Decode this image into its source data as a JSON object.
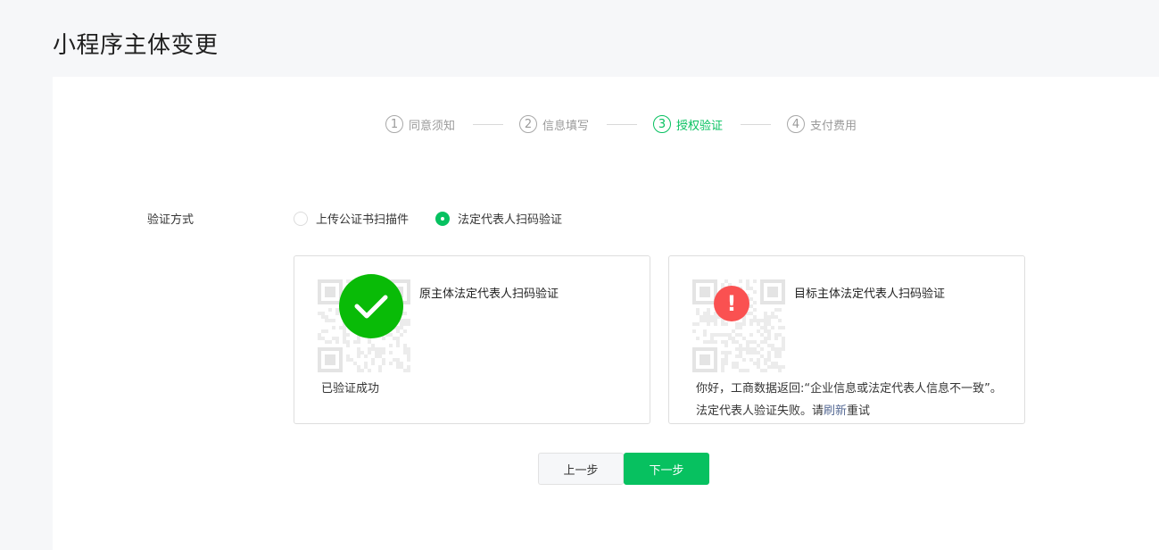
{
  "page": {
    "title": "小程序主体变更"
  },
  "steps": [
    {
      "num": "1",
      "label": "同意须知"
    },
    {
      "num": "2",
      "label": "信息填写"
    },
    {
      "num": "3",
      "label": "授权验证"
    },
    {
      "num": "4",
      "label": "支付费用"
    }
  ],
  "active_step": 3,
  "verify": {
    "label": "验证方式",
    "options": [
      {
        "label": "上传公证书扫描件",
        "selected": false
      },
      {
        "label": "法定代表人扫码验证",
        "selected": true
      }
    ]
  },
  "cards": {
    "original": {
      "title": "原主体法定代表人扫码验证",
      "status_icon": "check-icon",
      "message": "已验证成功"
    },
    "target": {
      "title": "目标主体法定代表人扫码验证",
      "status_icon": "exclamation-icon",
      "status_glyph": "!",
      "message_before": "你好，工商数据返回:“企业信息或法定代表人信息不一致”。法定代表人验证失败。请",
      "refresh_link": "刷新",
      "message_after": "重试"
    }
  },
  "buttons": {
    "prev": "上一步",
    "next": "下一步"
  },
  "colors": {
    "accent": "#07c160",
    "success": "#09bb07",
    "error": "#fa5151",
    "link": "#576b95"
  }
}
